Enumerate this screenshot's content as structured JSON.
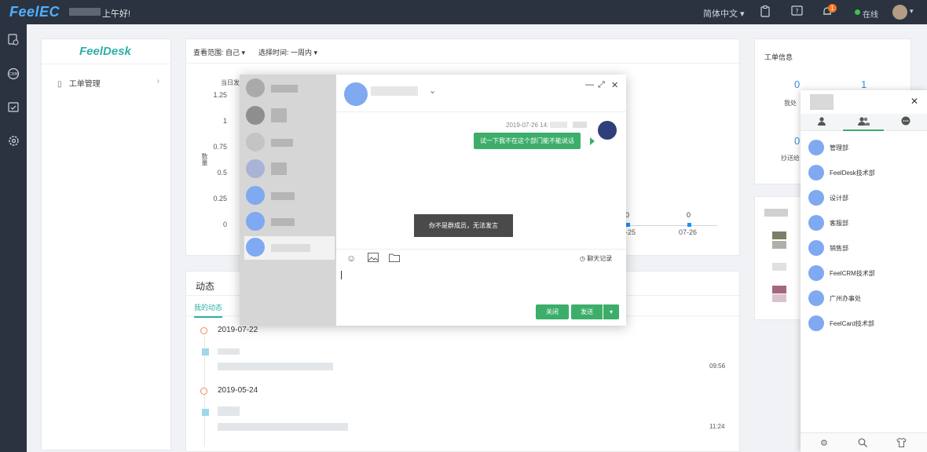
{
  "topbar": {
    "logo": "FeelEC",
    "greeting": "上午好!",
    "language": "简体中文",
    "notification_badge": "1",
    "status": "在线"
  },
  "nav": {
    "logo": "FeelDesk",
    "item_label": "工单管理"
  },
  "stats": {
    "filter_scope": "查看范围: 自己",
    "filter_time": "选择时间: 一周内",
    "chart_title": "当日发",
    "y_label": "数量"
  },
  "chart_data": {
    "type": "line",
    "title": "",
    "xlabel": "",
    "ylabel": "数量",
    "ylim": [
      0,
      1.25
    ],
    "y_ticks": [
      "1.25",
      "1",
      "0.75",
      "0.5",
      "0.25",
      "0"
    ],
    "x": [
      "07-25",
      "07-26"
    ],
    "series": [
      {
        "values": [
          0,
          0
        ]
      }
    ]
  },
  "dynamics": {
    "title": "动态",
    "tab": "我的动态",
    "entries": [
      {
        "date": "2019-07-22",
        "time": "09:56"
      },
      {
        "date": "2019-05-24",
        "time": "11:24"
      }
    ]
  },
  "workorder": {
    "title": "工单信息",
    "num1": "0",
    "num2": "1",
    "num3": "0",
    "label1": "我处",
    "label2": "抄送给"
  },
  "chat": {
    "message_time": "2019-07-26 14:",
    "message_text": "试一下我不在这个部门能不能说话",
    "toast": "你不是群成员，无法发言",
    "history": "聊天记录",
    "close_btn": "关闭",
    "send_btn": "发送"
  },
  "contacts": {
    "departments": [
      "管理部",
      "FeelDesk技术部",
      "设计部",
      "客服部",
      "销售部",
      "FeelCRM技术部",
      "广州办事处",
      "FeelCard技术部"
    ]
  },
  "colors": {
    "topbar": "#2c3340",
    "accent_green": "#3cae6a",
    "accent_teal": "#2fb0a5",
    "avatar_blue": "#7fa9f0"
  }
}
